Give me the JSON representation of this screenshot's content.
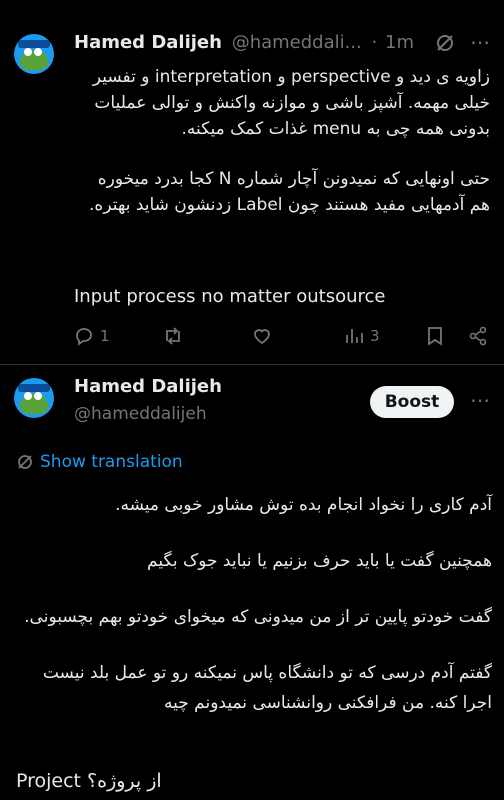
{
  "tweet1": {
    "author_name": "Hamed Dalijeh",
    "handle": "@hameddali...",
    "sep": "·",
    "time": "1m",
    "paragraph1": "زاویه ی دید و perspective و interpretation و تفسیر خیلی مهمه. آشپز باشی و موازنه واکنش و توالی عملیات بدونی همه چی به menu غذات کمک میکنه.",
    "paragraph2": "حتی اونهایی که نمیدونن آچار شماره N کجا بدرد میخوره هم آدمهایی مفید هستند چون Label زدنشون شاید بهتره.",
    "paragraph3": "Input process no matter outsource",
    "actions": {
      "reply_count": "1",
      "views_count": "3"
    }
  },
  "tweet2": {
    "author_name": "Hamed Dalijeh",
    "handle": "@hameddalijeh",
    "boost_label": "Boost",
    "show_translation": "Show translation",
    "p1": "آدم کاری را نخواد انجام بده توش مشاور خوبی میشه.",
    "p2": "همچنین گفت یا باید حرف بزنیم یا نباید جوک بگیم",
    "p3": "گفت خودتو پایین تر از من میدونی که میخوای خودتو بهم بچسبونی.",
    "p4": "گفتم آدم درسی که تو دانشگاه پاس نمیکنه رو تو عمل بلد نیست اجرا کنه. من فرافکنی روانشناسی نمیدونم چیه",
    "p5": "Project از پروژه؟"
  },
  "colors": {
    "background": "#000000",
    "text": "#e7e9ea",
    "muted": "#71767b",
    "link": "#1d9bf0"
  }
}
